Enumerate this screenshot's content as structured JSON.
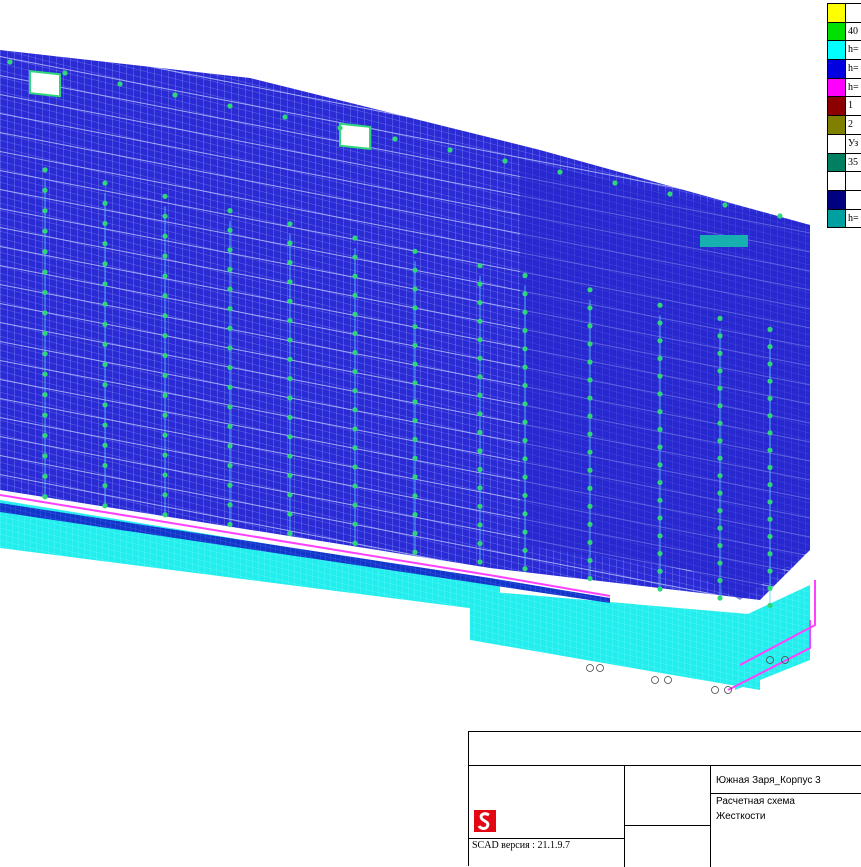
{
  "legend": {
    "rows": [
      {
        "color": "#ffff00",
        "label": ""
      },
      {
        "color": "#00e000",
        "label": "40"
      },
      {
        "color": "#00ffff",
        "label": "h="
      },
      {
        "color": "#0000e0",
        "label": "h="
      },
      {
        "color": "#ff00ff",
        "label": "h="
      },
      {
        "color": "#8b0000",
        "label": "1 "
      },
      {
        "color": "#808000",
        "label": "2 "
      },
      {
        "color": "#ffffff",
        "label": "Уз"
      },
      {
        "color": "#008060",
        "label": "35"
      },
      {
        "color": "#ffffff",
        "label": ""
      },
      {
        "color": "#000080",
        "label": ""
      },
      {
        "color": "#00a0a0",
        "label": "h="
      }
    ]
  },
  "title_block": {
    "project": "Южная Заря_Корпус 3",
    "scheme": "Расчетная схема",
    "subtitle": "Жесткости",
    "version": "SCAD версия : 21.1.9.7"
  },
  "colors": {
    "slab": "#2b2bd6",
    "mesh": "#7a8cff",
    "node": "#2fd67a",
    "foundation": "#21f0f0",
    "edge": "#ff40ff",
    "ground_slab": "#1030c0"
  }
}
